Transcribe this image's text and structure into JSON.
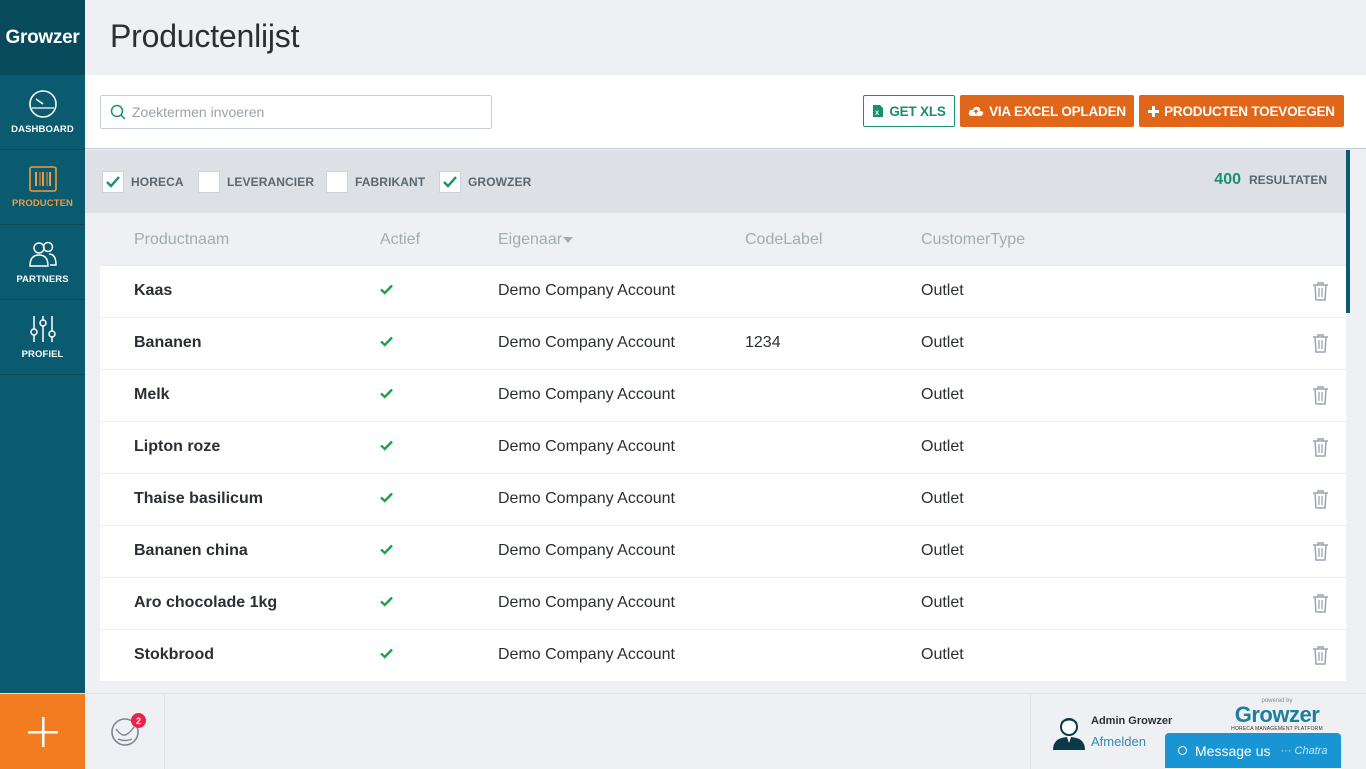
{
  "app": {
    "logo": "Growzer"
  },
  "sidebar": {
    "items": [
      {
        "label": "DASHBOARD",
        "icon": "dashboard-gauge-icon"
      },
      {
        "label": "PRODUCTEN",
        "icon": "barcode-icon",
        "active": true
      },
      {
        "label": "PARTNERS",
        "icon": "users-icon"
      },
      {
        "label": "PROFIEL",
        "icon": "sliders-icon"
      }
    ]
  },
  "header": {
    "title": "Productenlijst"
  },
  "toolbar": {
    "search_placeholder": "Zoektermen invoeren",
    "get_xls": "GET XLS",
    "excel_upload": "VIA EXCEL OPLADEN",
    "add_products": "PRODUCTEN TOEVOEGEN"
  },
  "filters": {
    "items": [
      {
        "label": "HORECA",
        "checked": true
      },
      {
        "label": "LEVERANCIER",
        "checked": false
      },
      {
        "label": "FABRIKANT",
        "checked": false
      },
      {
        "label": "GROWZER",
        "checked": true
      }
    ],
    "results_count": "400",
    "results_label": "RESULTATEN"
  },
  "table": {
    "columns": [
      "Productnaam",
      "Actief",
      "Eigenaar",
      "CodeLabel",
      "CustomerType"
    ],
    "rows": [
      {
        "name": "Kaas",
        "active": true,
        "owner": "Demo Company Account",
        "code": "",
        "type": "Outlet"
      },
      {
        "name": "Bananen",
        "active": true,
        "owner": "Demo Company Account",
        "code": "1234",
        "type": "Outlet"
      },
      {
        "name": "Melk",
        "active": true,
        "owner": "Demo Company Account",
        "code": "",
        "type": "Outlet"
      },
      {
        "name": "Lipton roze",
        "active": true,
        "owner": "Demo Company Account",
        "code": "",
        "type": "Outlet"
      },
      {
        "name": "Thaise basilicum",
        "active": true,
        "owner": "Demo Company Account",
        "code": "",
        "type": "Outlet"
      },
      {
        "name": "Bananen china",
        "active": true,
        "owner": "Demo Company Account",
        "code": "",
        "type": "Outlet"
      },
      {
        "name": "Aro chocolade 1kg",
        "active": true,
        "owner": "Demo Company Account",
        "code": "",
        "type": "Outlet"
      },
      {
        "name": "Stokbrood",
        "active": true,
        "owner": "Demo Company Account",
        "code": "",
        "type": "Outlet"
      }
    ]
  },
  "footer": {
    "notification_count": "2",
    "user_name": "Admin Growzer",
    "logout": "Afmelden",
    "powered_by": "powered by",
    "powered_logo": "Growzer",
    "powered_tagline": "HORECA MANAGEMENT PLATFORM",
    "chat_label": "Message us",
    "chat_brand": "Chatra"
  },
  "colors": {
    "sidebar": "#0a5a70",
    "accent_orange": "#e0661a",
    "accent_green": "#1a8f6e",
    "chat_blue": "#1a95d4"
  }
}
